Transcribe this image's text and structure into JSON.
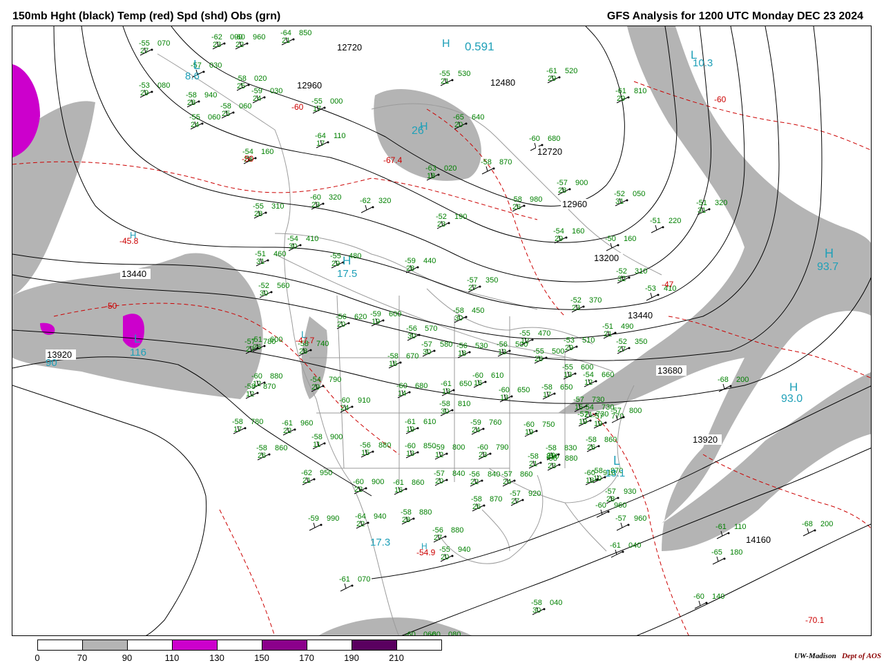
{
  "title_left": "150mb Hght (black) Temp (red) Spd (shd) Obs (grn)",
  "title_right": "GFS Analysis for 1200 UTC Monday  DEC 23 2024",
  "credit_org": "UW-Madison",
  "credit_dept": "Dept of AOS",
  "colorbar": {
    "ticks": [
      "0",
      "70",
      "90",
      "110",
      "130",
      "150",
      "170",
      "190",
      "210"
    ],
    "segments": [
      "#ffffff",
      "#b4b4b4",
      "#ffffff",
      "#cc00cc",
      "#ffffff",
      "#8b008b",
      "#ffffff",
      "#5a0060",
      "#ffffff"
    ]
  },
  "colors": {
    "height_contour": "#000000",
    "temp_contour": "#cc0000",
    "speed_shade_70": "#b4b4b4",
    "speed_shade_110": "#cc00cc",
    "obs_text": "#008000",
    "max_min_label": "#1fa0b8",
    "boundaries": "#9a9a9a"
  },
  "height_labels": [
    "12720",
    "12960",
    "12480",
    "12720",
    "12960",
    "13200",
    "13440",
    "13440",
    "13680",
    "13920",
    "13920",
    "14160"
  ],
  "temp_labels": [
    "-60",
    "-50",
    "-67.4",
    "-50",
    "-60",
    "-45.8",
    "-47.7",
    "-54.9",
    "-47",
    "-70.1"
  ],
  "height_extrema": [
    "L",
    "L",
    "H",
    "H",
    "H",
    "H",
    "L",
    "L",
    "H",
    "L",
    "H",
    "H"
  ],
  "speed_extrema": [
    "8.6",
    "10.3",
    "0.591",
    "26",
    "17.5",
    "116",
    "93.7",
    "93.0",
    "17.3",
    "13.1",
    "90"
  ],
  "observations": [
    {
      "t": "-55",
      "h": "070",
      "s": "27"
    },
    {
      "t": "-62",
      "h": "090",
      "s": "23"
    },
    {
      "t": "-60",
      "h": "960",
      "s": "22"
    },
    {
      "t": "-64",
      "h": "850",
      "s": "21"
    },
    {
      "t": "-57",
      "h": "030",
      "s": ""
    },
    {
      "t": "-53",
      "h": "080",
      "s": "29"
    },
    {
      "t": "-58",
      "h": "020",
      "s": "25"
    },
    {
      "t": "-59",
      "h": "030",
      "s": "24"
    },
    {
      "t": "-58",
      "h": "940",
      "s": "28"
    },
    {
      "t": "-58",
      "h": "060",
      "s": "25"
    },
    {
      "t": "-55",
      "h": "060",
      "s": "24"
    },
    {
      "t": "-55",
      "h": "000",
      "s": "17"
    },
    {
      "t": "-55",
      "h": "530",
      "s": "21"
    },
    {
      "t": "-65",
      "h": "640",
      "s": "20"
    },
    {
      "t": "-61",
      "h": "520",
      "s": "29"
    },
    {
      "t": "-61",
      "h": "810",
      "s": "29"
    },
    {
      "t": "-60",
      "h": "680",
      "s": ""
    },
    {
      "t": "-54",
      "h": "160",
      "s": "23"
    },
    {
      "t": "-64",
      "h": "110",
      "s": "17"
    },
    {
      "t": "-63",
      "h": "020",
      "s": "18"
    },
    {
      "t": "-57",
      "h": "900",
      "s": "28"
    },
    {
      "t": "-52",
      "h": "050",
      "s": "31"
    },
    {
      "t": "-51",
      "h": "320",
      "s": "31"
    },
    {
      "t": "-60",
      "h": "320",
      "s": "23"
    },
    {
      "t": "-62",
      "h": "320",
      "s": ""
    },
    {
      "t": "-55",
      "h": "310",
      "s": "28"
    },
    {
      "t": "-58",
      "h": "980",
      "s": "26"
    },
    {
      "t": "-52",
      "h": "190",
      "s": "23"
    },
    {
      "t": "-54",
      "h": "160",
      "s": "29"
    },
    {
      "t": "-51",
      "h": "220",
      "s": ""
    },
    {
      "t": "-54",
      "h": "410",
      "s": "30"
    },
    {
      "t": "-50",
      "h": "160",
      "s": ""
    },
    {
      "t": "-55",
      "h": "480",
      "s": "29"
    },
    {
      "t": "-51",
      "h": "460",
      "s": "31"
    },
    {
      "t": "-59",
      "h": "440",
      "s": "28"
    },
    {
      "t": "-52",
      "h": "310",
      "s": "32"
    },
    {
      "t": "-53",
      "h": "410",
      "s": ""
    },
    {
      "t": "-52",
      "h": "560",
      "s": "30"
    },
    {
      "t": "-57",
      "h": "350",
      "s": "27"
    },
    {
      "t": "-52",
      "h": "370",
      "s": "23"
    },
    {
      "t": "-56",
      "h": "620",
      "s": "20"
    },
    {
      "t": "-59",
      "h": "600",
      "s": "19"
    },
    {
      "t": "-58",
      "h": "450",
      "s": "30"
    },
    {
      "t": "-51",
      "h": "490",
      "s": "21"
    },
    {
      "t": "-53",
      "h": "510",
      "s": "29"
    },
    {
      "t": "-52",
      "h": "350",
      "s": "27"
    },
    {
      "t": "-51",
      "h": "600",
      "s": "26"
    },
    {
      "t": "-57",
      "h": "780",
      "s": "27"
    },
    {
      "t": "-58",
      "h": "740",
      "s": "28"
    },
    {
      "t": "-56",
      "h": "570",
      "s": "30"
    },
    {
      "t": "-57",
      "h": "580",
      "s": "30"
    },
    {
      "t": "-56",
      "h": "530",
      "s": "18"
    },
    {
      "t": "-56",
      "h": "500",
      "s": "13"
    },
    {
      "t": "-55",
      "h": "470",
      "s": "12"
    },
    {
      "t": "-55",
      "h": "500",
      "s": "26"
    },
    {
      "t": "-55",
      "h": "600",
      "s": "13"
    },
    {
      "t": "-54",
      "h": "660",
      "s": "12"
    },
    {
      "t": "-57",
      "h": "730",
      "s": "15"
    },
    {
      "t": "-54",
      "h": "730",
      "s": "21"
    },
    {
      "t": "-58",
      "h": "670",
      "s": "16"
    },
    {
      "t": "-60",
      "h": "880",
      "s": "12"
    },
    {
      "t": "-54",
      "h": "790",
      "s": "29"
    },
    {
      "t": "-60",
      "h": "680",
      "s": "14"
    },
    {
      "t": "-61",
      "h": "650",
      "s": "13"
    },
    {
      "t": "-60",
      "h": "610",
      "s": "16"
    },
    {
      "t": "-60",
      "h": "650",
      "s": "13"
    },
    {
      "t": "-58",
      "h": "650",
      "s": "17"
    },
    {
      "t": "-57",
      "h": "730",
      "s": "19"
    },
    {
      "t": "-57",
      "h": "770",
      "s": "19"
    },
    {
      "t": "-57",
      "h": "800",
      "s": ""
    },
    {
      "t": "-58",
      "h": "870",
      "s": "12"
    },
    {
      "t": "-60",
      "h": "910",
      "s": "24"
    },
    {
      "t": "-58",
      "h": "810",
      "s": "30"
    },
    {
      "t": "-61",
      "h": "610",
      "s": "19"
    },
    {
      "t": "-59",
      "h": "760",
      "s": "24"
    },
    {
      "t": "-60",
      "h": "750",
      "s": "19"
    },
    {
      "t": "-58",
      "h": "780",
      "s": "17"
    },
    {
      "t": "-61",
      "h": "960",
      "s": "22"
    },
    {
      "t": "-58",
      "h": "900",
      "s": "11"
    },
    {
      "t": "-56",
      "h": "880",
      "s": "15"
    },
    {
      "t": "-60",
      "h": "850",
      "s": "13"
    },
    {
      "t": "-59",
      "h": "800",
      "s": "12"
    },
    {
      "t": "-60",
      "h": "790",
      "s": "23"
    },
    {
      "t": "-58",
      "h": "810",
      "s": "21"
    },
    {
      "t": "-58",
      "h": "830",
      "s": "29"
    },
    {
      "t": "-58",
      "h": "860",
      "s": "26"
    },
    {
      "t": "-58",
      "h": "860",
      "s": "26"
    },
    {
      "t": "-62",
      "h": "950",
      "s": "21"
    },
    {
      "t": "-60",
      "h": "900",
      "s": "22"
    },
    {
      "t": "-61",
      "h": "860",
      "s": "16"
    },
    {
      "t": "-57",
      "h": "840",
      "s": "20"
    },
    {
      "t": "-56",
      "h": "840",
      "s": "22"
    },
    {
      "t": "-57",
      "h": "860",
      "s": "24"
    },
    {
      "t": "-58",
      "h": "880",
      "s": "23"
    },
    {
      "t": "-60",
      "h": "910",
      "s": "18"
    },
    {
      "t": "-58",
      "h": "870",
      "s": "10"
    },
    {
      "t": "-58",
      "h": "870",
      "s": "26"
    },
    {
      "t": "-57",
      "h": "920",
      "s": "27"
    },
    {
      "t": "-57",
      "h": "930",
      "s": "28"
    },
    {
      "t": "-60",
      "h": "960",
      "s": ""
    },
    {
      "t": "-59",
      "h": "990",
      "s": ""
    },
    {
      "t": "-64",
      "h": "940",
      "s": "22"
    },
    {
      "t": "-58",
      "h": "880",
      "s": "28"
    },
    {
      "t": "-56",
      "h": "880",
      "s": "27"
    },
    {
      "t": "-55",
      "h": "940",
      "s": "20"
    },
    {
      "t": "-57",
      "h": "960",
      "s": ""
    },
    {
      "t": "-61",
      "h": "040",
      "s": ""
    },
    {
      "t": "-61",
      "h": "070",
      "s": ""
    },
    {
      "t": "-58",
      "h": "040",
      "s": "30"
    },
    {
      "t": "-60",
      "h": "140",
      "s": ""
    },
    {
      "t": "-60",
      "h": "060",
      "s": ""
    },
    {
      "t": "-60",
      "h": "080",
      "s": ""
    },
    {
      "t": "-61",
      "h": "110",
      "s": ""
    },
    {
      "t": "-65",
      "h": "180",
      "s": ""
    },
    {
      "t": "-68",
      "h": "200",
      "s": ""
    },
    {
      "t": "-68",
      "h": "200",
      "s": ""
    },
    {
      "t": "-58",
      "h": "870",
      "s": ""
    }
  ]
}
